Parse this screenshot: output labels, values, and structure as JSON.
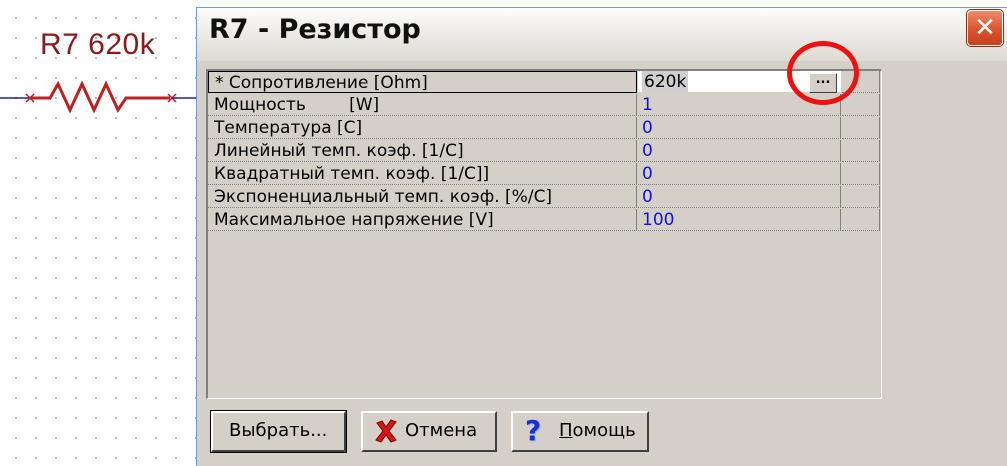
{
  "schematic": {
    "ref_label": "R7 620k"
  },
  "window": {
    "title": "R7 - Резистор",
    "close_glyph": "✕"
  },
  "properties": [
    {
      "name": "* Сопротивление [Ohm]",
      "value": "620k",
      "editing": true
    },
    {
      "name": "Мощность        [W]",
      "value": "1"
    },
    {
      "name": "Температура [C]",
      "value": "0"
    },
    {
      "name": "Линейный темп. коэф. [1/C]",
      "value": "0"
    },
    {
      "name": "Квадратный темп. коэф. [1/C]]",
      "value": "0"
    },
    {
      "name": "Экспоненциальный темп. коэф. [%/C]",
      "value": "0"
    },
    {
      "name": "Максимальное напряжение [V]",
      "value": "100"
    }
  ],
  "browse_button": {
    "label": "..."
  },
  "buttons": {
    "choose": "Выбрать...",
    "cancel": "Отмена",
    "help_accel": "П",
    "help_rest": "омощь"
  },
  "icons": {
    "cancel": "red-x-icon",
    "help": "question-mark-icon"
  },
  "colors": {
    "value_text": "#1212d8",
    "highlight": "#ee1111",
    "schematic_label": "#8b1a1a"
  }
}
